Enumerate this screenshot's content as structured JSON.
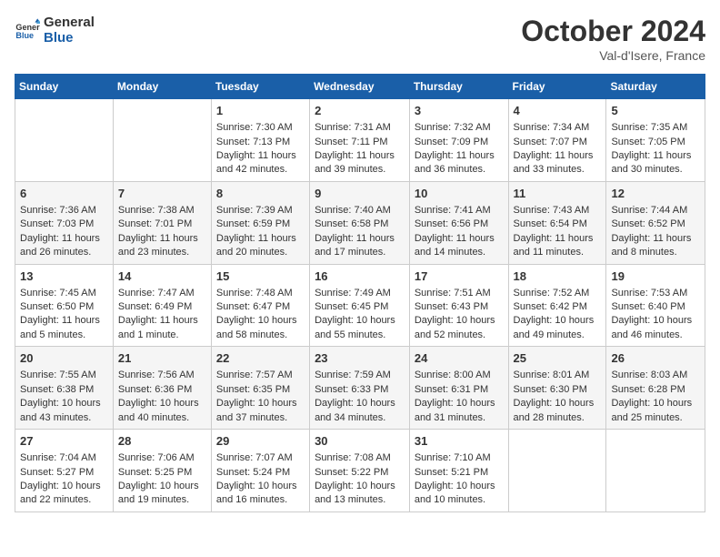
{
  "header": {
    "logo_line1": "General",
    "logo_line2": "Blue",
    "month": "October 2024",
    "location": "Val-d'Isere, France"
  },
  "days_of_week": [
    "Sunday",
    "Monday",
    "Tuesday",
    "Wednesday",
    "Thursday",
    "Friday",
    "Saturday"
  ],
  "weeks": [
    [
      {
        "day": "",
        "info": ""
      },
      {
        "day": "",
        "info": ""
      },
      {
        "day": "1",
        "info": "Sunrise: 7:30 AM\nSunset: 7:13 PM\nDaylight: 11 hours and 42 minutes."
      },
      {
        "day": "2",
        "info": "Sunrise: 7:31 AM\nSunset: 7:11 PM\nDaylight: 11 hours and 39 minutes."
      },
      {
        "day": "3",
        "info": "Sunrise: 7:32 AM\nSunset: 7:09 PM\nDaylight: 11 hours and 36 minutes."
      },
      {
        "day": "4",
        "info": "Sunrise: 7:34 AM\nSunset: 7:07 PM\nDaylight: 11 hours and 33 minutes."
      },
      {
        "day": "5",
        "info": "Sunrise: 7:35 AM\nSunset: 7:05 PM\nDaylight: 11 hours and 30 minutes."
      }
    ],
    [
      {
        "day": "6",
        "info": "Sunrise: 7:36 AM\nSunset: 7:03 PM\nDaylight: 11 hours and 26 minutes."
      },
      {
        "day": "7",
        "info": "Sunrise: 7:38 AM\nSunset: 7:01 PM\nDaylight: 11 hours and 23 minutes."
      },
      {
        "day": "8",
        "info": "Sunrise: 7:39 AM\nSunset: 6:59 PM\nDaylight: 11 hours and 20 minutes."
      },
      {
        "day": "9",
        "info": "Sunrise: 7:40 AM\nSunset: 6:58 PM\nDaylight: 11 hours and 17 minutes."
      },
      {
        "day": "10",
        "info": "Sunrise: 7:41 AM\nSunset: 6:56 PM\nDaylight: 11 hours and 14 minutes."
      },
      {
        "day": "11",
        "info": "Sunrise: 7:43 AM\nSunset: 6:54 PM\nDaylight: 11 hours and 11 minutes."
      },
      {
        "day": "12",
        "info": "Sunrise: 7:44 AM\nSunset: 6:52 PM\nDaylight: 11 hours and 8 minutes."
      }
    ],
    [
      {
        "day": "13",
        "info": "Sunrise: 7:45 AM\nSunset: 6:50 PM\nDaylight: 11 hours and 5 minutes."
      },
      {
        "day": "14",
        "info": "Sunrise: 7:47 AM\nSunset: 6:49 PM\nDaylight: 11 hours and 1 minute."
      },
      {
        "day": "15",
        "info": "Sunrise: 7:48 AM\nSunset: 6:47 PM\nDaylight: 10 hours and 58 minutes."
      },
      {
        "day": "16",
        "info": "Sunrise: 7:49 AM\nSunset: 6:45 PM\nDaylight: 10 hours and 55 minutes."
      },
      {
        "day": "17",
        "info": "Sunrise: 7:51 AM\nSunset: 6:43 PM\nDaylight: 10 hours and 52 minutes."
      },
      {
        "day": "18",
        "info": "Sunrise: 7:52 AM\nSunset: 6:42 PM\nDaylight: 10 hours and 49 minutes."
      },
      {
        "day": "19",
        "info": "Sunrise: 7:53 AM\nSunset: 6:40 PM\nDaylight: 10 hours and 46 minutes."
      }
    ],
    [
      {
        "day": "20",
        "info": "Sunrise: 7:55 AM\nSunset: 6:38 PM\nDaylight: 10 hours and 43 minutes."
      },
      {
        "day": "21",
        "info": "Sunrise: 7:56 AM\nSunset: 6:36 PM\nDaylight: 10 hours and 40 minutes."
      },
      {
        "day": "22",
        "info": "Sunrise: 7:57 AM\nSunset: 6:35 PM\nDaylight: 10 hours and 37 minutes."
      },
      {
        "day": "23",
        "info": "Sunrise: 7:59 AM\nSunset: 6:33 PM\nDaylight: 10 hours and 34 minutes."
      },
      {
        "day": "24",
        "info": "Sunrise: 8:00 AM\nSunset: 6:31 PM\nDaylight: 10 hours and 31 minutes."
      },
      {
        "day": "25",
        "info": "Sunrise: 8:01 AM\nSunset: 6:30 PM\nDaylight: 10 hours and 28 minutes."
      },
      {
        "day": "26",
        "info": "Sunrise: 8:03 AM\nSunset: 6:28 PM\nDaylight: 10 hours and 25 minutes."
      }
    ],
    [
      {
        "day": "27",
        "info": "Sunrise: 7:04 AM\nSunset: 5:27 PM\nDaylight: 10 hours and 22 minutes."
      },
      {
        "day": "28",
        "info": "Sunrise: 7:06 AM\nSunset: 5:25 PM\nDaylight: 10 hours and 19 minutes."
      },
      {
        "day": "29",
        "info": "Sunrise: 7:07 AM\nSunset: 5:24 PM\nDaylight: 10 hours and 16 minutes."
      },
      {
        "day": "30",
        "info": "Sunrise: 7:08 AM\nSunset: 5:22 PM\nDaylight: 10 hours and 13 minutes."
      },
      {
        "day": "31",
        "info": "Sunrise: 7:10 AM\nSunset: 5:21 PM\nDaylight: 10 hours and 10 minutes."
      },
      {
        "day": "",
        "info": ""
      },
      {
        "day": "",
        "info": ""
      }
    ]
  ]
}
